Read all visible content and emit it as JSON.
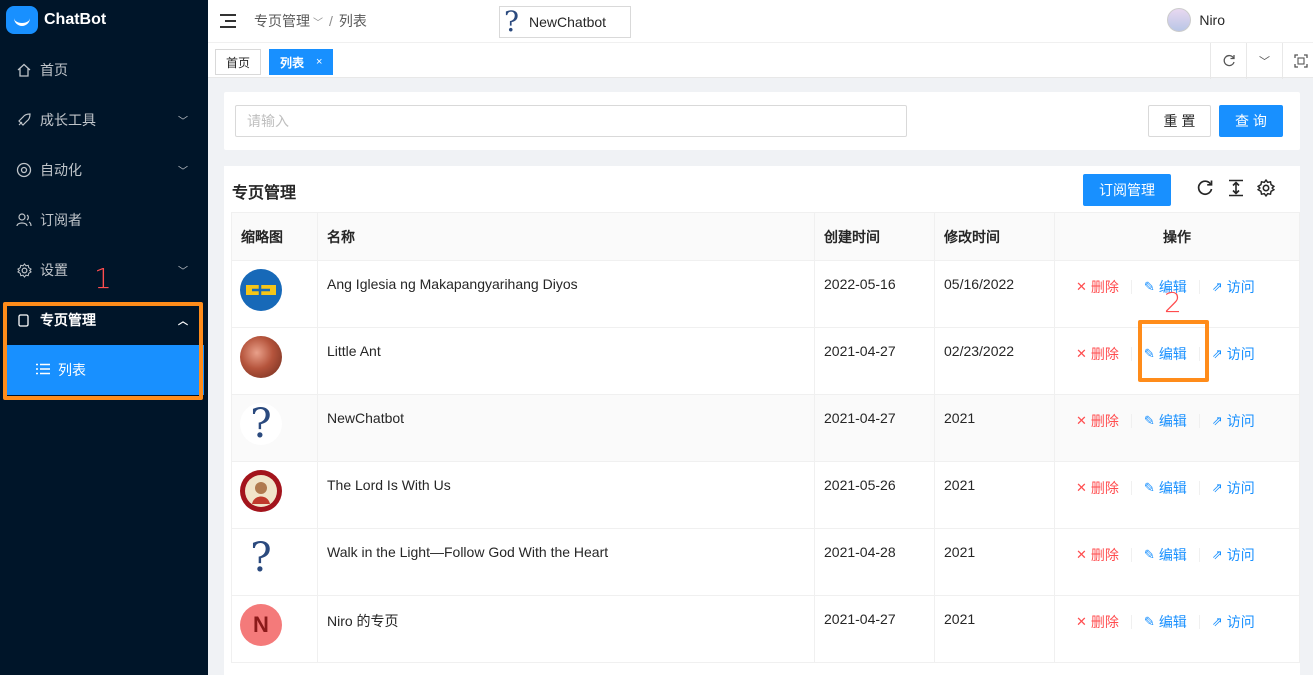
{
  "app": {
    "name": "ChatBot"
  },
  "sidebar": {
    "items": [
      {
        "label": "首页",
        "icon": "home-icon"
      },
      {
        "label": "成长工具",
        "icon": "rocket-icon",
        "has_children": true
      },
      {
        "label": "自动化",
        "icon": "robot-icon",
        "has_children": true
      },
      {
        "label": "订阅者",
        "icon": "users-icon"
      },
      {
        "label": "设置",
        "icon": "gear-icon",
        "has_children": true
      },
      {
        "label": "专页管理",
        "icon": "page-icon",
        "open": true
      }
    ],
    "sub_items": [
      {
        "label": "列表",
        "icon": "list-icon",
        "selected": true
      }
    ]
  },
  "annotations": {
    "one": "1",
    "two": "2",
    "color": "#ff8c1a"
  },
  "header": {
    "breadcrumb": {
      "parent": "专页管理",
      "sep": "/",
      "current": "列表"
    },
    "bot_selector": {
      "label": "NewChatbot"
    },
    "user": {
      "name": "Niro"
    }
  },
  "tabs": [
    {
      "label": "首页",
      "active": false
    },
    {
      "label": "列表",
      "active": true,
      "close": "×"
    }
  ],
  "search": {
    "placeholder": "请输入",
    "value": "",
    "reset_label": "重 置",
    "query_label": "查 询"
  },
  "table_panel": {
    "title": "专页管理",
    "subscribe_button": "订阅管理",
    "columns": [
      "缩略图",
      "名称",
      "创建时间",
      "修改时间",
      "操作"
    ],
    "actions": {
      "delete": "删除",
      "edit": "编辑",
      "visit": "访问"
    },
    "rows": [
      {
        "thumb": "church-logo",
        "name": "Ang Iglesia ng Makapangyarihang Diyos",
        "created": "2022-05-16",
        "modified": "05/16/2022"
      },
      {
        "thumb": "photo",
        "name": "Little Ant",
        "created": "2021-04-27",
        "modified": "02/23/2022"
      },
      {
        "thumb": "question-mark",
        "name": "NewChatbot",
        "created": "2021-04-27",
        "modified": "2021"
      },
      {
        "thumb": "jesus-logo",
        "name": "The Lord Is With Us",
        "created": "2021-05-26",
        "modified": "2021"
      },
      {
        "thumb": "question-mark",
        "name": "Walk in the Light—Follow God With the Heart",
        "created": "2021-04-28",
        "modified": "2021"
      },
      {
        "thumb": "letter-avatar",
        "letter": "N",
        "name": "Niro 的专页",
        "created": "2021-04-27",
        "modified": "2021"
      }
    ]
  },
  "colors": {
    "sidebar": "#001529",
    "primary": "#1890ff",
    "danger": "#ff4d4f",
    "highlight": "#ff8c1a"
  }
}
